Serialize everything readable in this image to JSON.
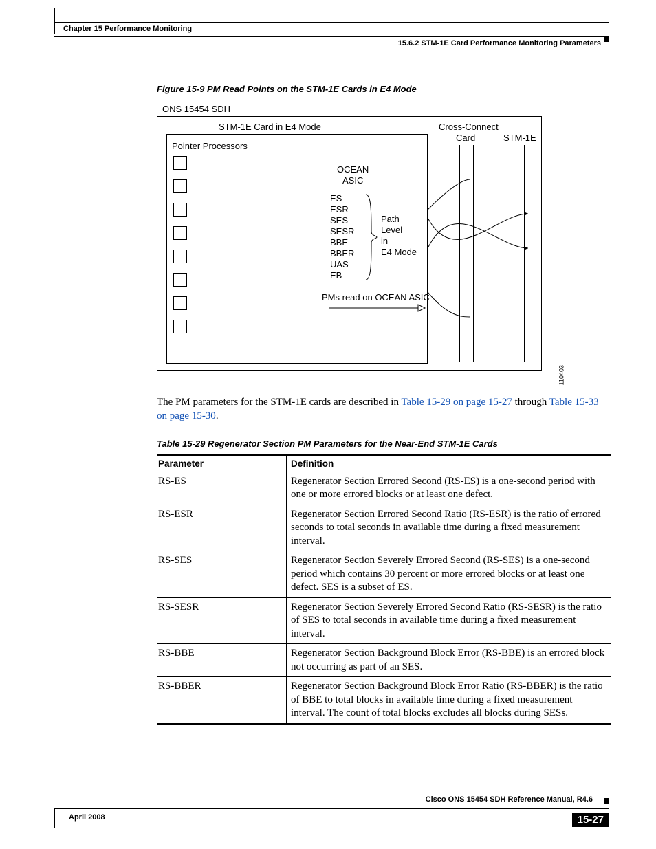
{
  "header": {
    "chapter": "Chapter 15    Performance Monitoring",
    "section": "15.6.2  STM-1E Card Performance Monitoring Parameters"
  },
  "figure": {
    "caption": "Figure 15-9   PM Read Points on the STM-1E Cards in E4 Mode",
    "labels": {
      "top": "ONS 15454 SDH",
      "card": "STM-1E Card in E4 Mode",
      "pp": "Pointer Processors",
      "ocean1": "OCEAN",
      "ocean2": "ASIC",
      "pm1": "ES",
      "pm2": "ESR",
      "pm3": "SES",
      "pm4": "SESR",
      "pm5": "BBE",
      "pm6": "BBER",
      "pm7": "UAS",
      "pm8": "EB",
      "path1": "Path",
      "path2": "Level",
      "path3": "in",
      "path4": "E4 Mode",
      "foot": "PMs read on OCEAN ASIC",
      "cc1": "Cross-Connect",
      "cc2": "Card",
      "stm": "STM-1E",
      "id": "110403"
    }
  },
  "body": {
    "p1a": "The PM parameters for the STM-1E cards are described in ",
    "p1link1": "Table 15-29 on page 15-27",
    "p1b": " through ",
    "p1link2": "Table 15-33 on page 15-30",
    "p1c": "."
  },
  "table": {
    "caption": "Table 15-29 Regenerator Section PM Parameters for the Near-End STM-1E Cards",
    "h1": "Parameter",
    "h2": "Definition",
    "rows": [
      {
        "p": "RS-ES",
        "d": "Regenerator Section Errored Second (RS-ES) is a one-second period with one or more errored blocks or at least one defect."
      },
      {
        "p": "RS-ESR",
        "d": "Regenerator Section Errored Second Ratio (RS-ESR) is the ratio of errored seconds to total seconds in available time during a fixed measurement interval."
      },
      {
        "p": "RS-SES",
        "d": "Regenerator Section Severely Errored Second (RS-SES) is a one-second period which contains 30 percent or more errored blocks or at least one defect. SES is a subset of ES."
      },
      {
        "p": "RS-SESR",
        "d": "Regenerator Section Severely Errored Second Ratio (RS-SESR) is the ratio of SES to total seconds in available time during a fixed measurement interval."
      },
      {
        "p": "RS-BBE",
        "d": "Regenerator Section Background Block Error (RS-BBE) is an errored block not occurring as part of an SES."
      },
      {
        "p": "RS-BBER",
        "d": "Regenerator Section Background Block Error Ratio (RS-BBER) is the ratio of BBE to total blocks in available time during a fixed measurement interval. The count of total blocks excludes all blocks during SESs."
      }
    ]
  },
  "footer": {
    "manual": "Cisco ONS 15454 SDH Reference Manual, R4.6",
    "date": "April 2008",
    "page": "15-27"
  }
}
